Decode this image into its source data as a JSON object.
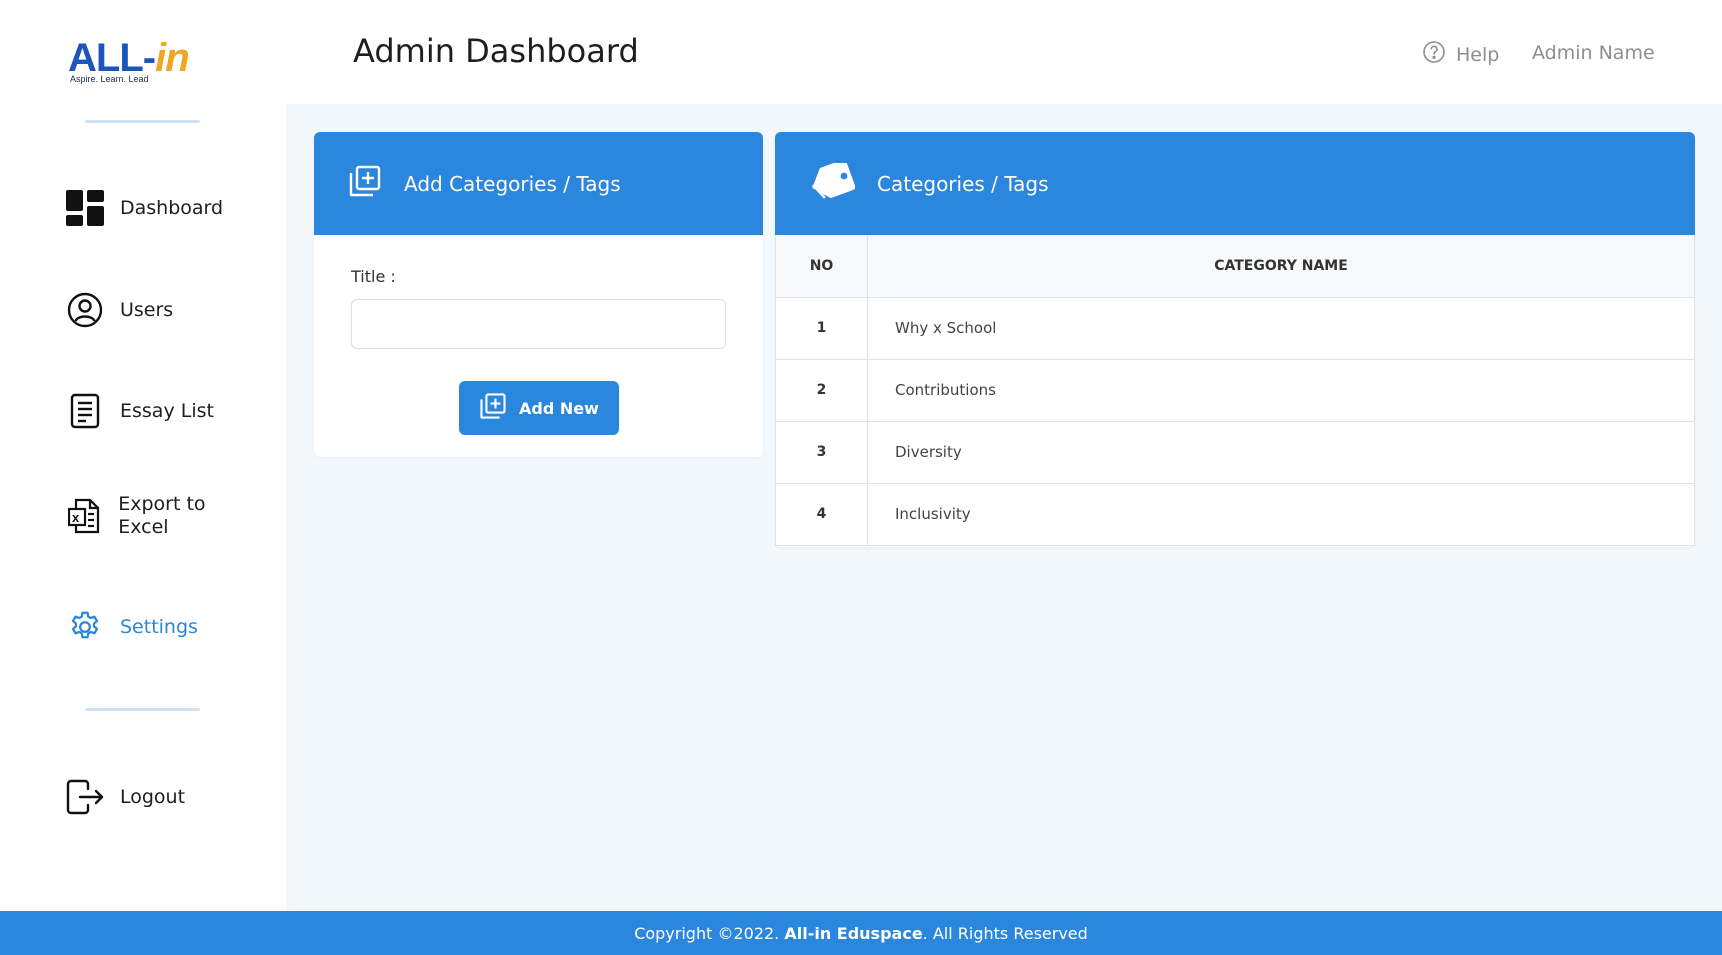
{
  "logo": {
    "text_main": "ALL-",
    "text_accent": "in",
    "tagline": "Aspire. Learn. Lead"
  },
  "sidebar": {
    "items": [
      {
        "label": "Dashboard",
        "icon": "dashboard-icon"
      },
      {
        "label": "Users",
        "icon": "user-circle-icon"
      },
      {
        "label": "Essay List",
        "icon": "document-list-icon"
      },
      {
        "label": "Export to Excel",
        "icon": "excel-icon"
      },
      {
        "label": "Settings",
        "icon": "gear-icon",
        "active": true
      },
      {
        "label": "Logout",
        "icon": "logout-icon"
      }
    ]
  },
  "header": {
    "title": "Admin Dashboard",
    "help_label": "Help",
    "user_name": "Admin Name"
  },
  "add_card": {
    "title": "Add Categories / Tags",
    "field_label": "Title :",
    "input_value": "",
    "button_label": "Add New"
  },
  "list_card": {
    "title": "Categories / Tags",
    "columns": [
      "NO",
      "CATEGORY NAME"
    ],
    "rows": [
      {
        "no": "1",
        "name": "Why x School"
      },
      {
        "no": "2",
        "name": "Contributions"
      },
      {
        "no": "3",
        "name": "Diversity"
      },
      {
        "no": "4",
        "name": "Inclusivity"
      }
    ]
  },
  "footer": {
    "prefix": "Copyright ©2022. ",
    "brand": "All-in Eduspace",
    "suffix": ". All Rights Reserved"
  },
  "colors": {
    "accent": "#2b86dd",
    "background": "#f3f8fc",
    "logo_blue": "#1a56b8",
    "logo_orange": "#f2a521"
  }
}
